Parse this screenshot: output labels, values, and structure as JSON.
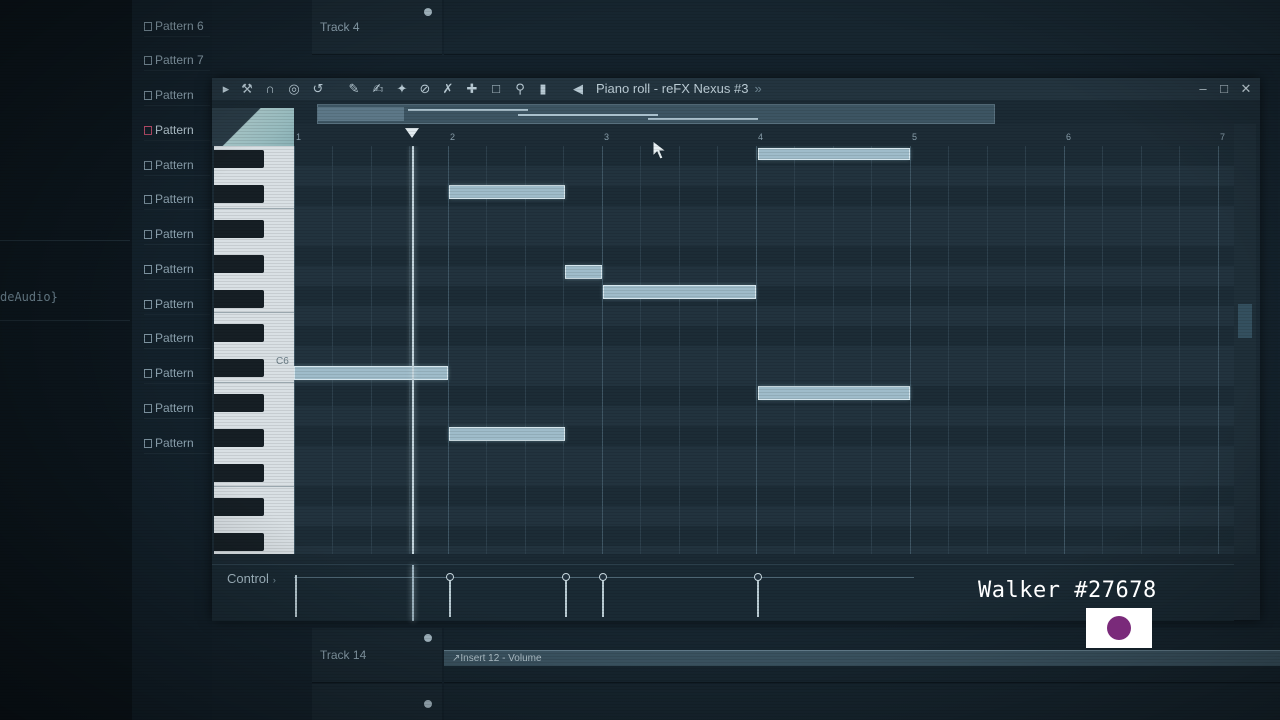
{
  "left_panel": {
    "partial_text": "deAudio}"
  },
  "patterns": [
    {
      "label": "Pattern 6"
    },
    {
      "label": "Pattern 7"
    },
    {
      "label": "Pattern"
    },
    {
      "label": "Pattern"
    },
    {
      "label": "Pattern"
    },
    {
      "label": "Pattern"
    },
    {
      "label": "Pattern"
    },
    {
      "label": "Pattern"
    },
    {
      "label": "Pattern"
    },
    {
      "label": "Pattern"
    },
    {
      "label": "Pattern"
    },
    {
      "label": "Pattern"
    },
    {
      "label": "Pattern"
    }
  ],
  "playlist": {
    "track_top": "Track 4",
    "track_bottom": "Track 14",
    "automation_clip": "↗Insert 12 - Volume"
  },
  "piano_roll": {
    "title": "Piano roll - reFX Nexus #3",
    "title_arrow": "»",
    "key_label": "C6",
    "ruler_numbers": [
      "1",
      "2",
      "3",
      "4",
      "5",
      "6",
      "7"
    ],
    "control_label": "Control",
    "control_arrow": "›",
    "window_controls": {
      "minimize": "–",
      "maximize": "□",
      "close": "✕"
    },
    "toolbar_icons": [
      "play-arrow-icon",
      "wrench-icon",
      "magnet-icon",
      "target-icon",
      "undo-icon",
      "pencil-icon",
      "paint-brush-icon",
      "paint-tool-icon",
      "delete-icon",
      "mute-icon",
      "slice-icon",
      "select-icon",
      "zoom-icon",
      "playback-icon",
      "speaker-icon"
    ]
  },
  "overlay": {
    "watermark": "Walker #27678",
    "flag_color": "#7a2a7a"
  },
  "colors": {
    "note_fill": "#9fbcca",
    "grid_bg": "#22333e"
  }
}
